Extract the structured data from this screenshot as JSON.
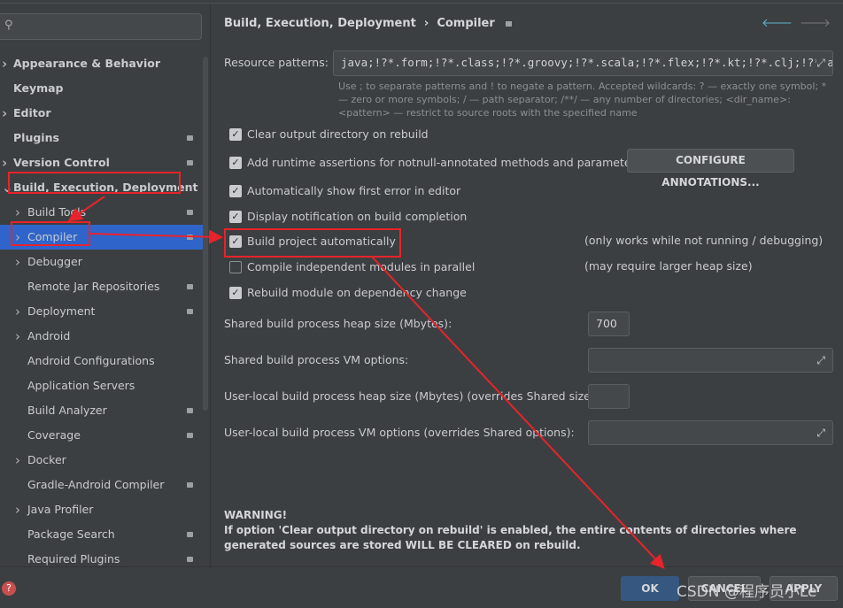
{
  "search": {
    "placeholder": ""
  },
  "sidebar": {
    "items": [
      {
        "label": "Appearance & Behavior",
        "level": 0,
        "chevron": true,
        "lock": false
      },
      {
        "label": "Keymap",
        "level": 0,
        "chevron": false,
        "lock": false
      },
      {
        "label": "Editor",
        "level": 0,
        "chevron": true,
        "lock": false
      },
      {
        "label": "Plugins",
        "level": 0,
        "chevron": false,
        "lock": true
      },
      {
        "label": "Version Control",
        "level": 0,
        "chevron": true,
        "lock": true
      },
      {
        "label": "Build, Execution, Deployment",
        "level": 0,
        "chevron": "open",
        "lock": false
      },
      {
        "label": "Build Tools",
        "level": 1,
        "chevron": true,
        "lock": true
      },
      {
        "label": "Compiler",
        "level": 1,
        "chevron": true,
        "lock": true,
        "selected": true
      },
      {
        "label": "Debugger",
        "level": 1,
        "chevron": true,
        "lock": false
      },
      {
        "label": "Remote Jar Repositories",
        "level": 1,
        "chevron": false,
        "lock": true
      },
      {
        "label": "Deployment",
        "level": 1,
        "chevron": true,
        "lock": true
      },
      {
        "label": "Android",
        "level": 1,
        "chevron": true,
        "lock": false
      },
      {
        "label": "Android Configurations",
        "level": 1,
        "chevron": false,
        "lock": false
      },
      {
        "label": "Application Servers",
        "level": 1,
        "chevron": false,
        "lock": false
      },
      {
        "label": "Build Analyzer",
        "level": 1,
        "chevron": false,
        "lock": true
      },
      {
        "label": "Coverage",
        "level": 1,
        "chevron": false,
        "lock": true
      },
      {
        "label": "Docker",
        "level": 1,
        "chevron": true,
        "lock": false
      },
      {
        "label": "Gradle-Android Compiler",
        "level": 1,
        "chevron": false,
        "lock": true
      },
      {
        "label": "Java Profiler",
        "level": 1,
        "chevron": true,
        "lock": false
      },
      {
        "label": "Package Search",
        "level": 1,
        "chevron": false,
        "lock": true
      },
      {
        "label": "Required Plugins",
        "level": 1,
        "chevron": false,
        "lock": true
      }
    ]
  },
  "header": {
    "breadcrumb_parent": "Build, Execution, Deployment",
    "separator": "›",
    "breadcrumb_current": "Compiler"
  },
  "resource": {
    "label": "Resource patterns:",
    "value": "java;!?*.form;!?*.class;!?*.groovy;!?*.scala;!?*.flex;!?*.kt;!?*.clj;!?*.aj",
    "hint": "Use ; to separate patterns and ! to negate a pattern. Accepted wildcards: ? — exactly one symbol; * — zero or more symbols; / — path separator; /**/ — any number of directories; <dir_name>:<pattern> — restrict to source roots with the specified name"
  },
  "options": [
    {
      "label": "Clear output directory on rebuild",
      "checked": true
    },
    {
      "label": "Add runtime assertions for notnull-annotated methods and parameters",
      "checked": true
    },
    {
      "label": "Automatically show first error in editor",
      "checked": true
    },
    {
      "label": "Display notification on build completion",
      "checked": true
    },
    {
      "label": "Build project automatically",
      "checked": true,
      "note": "(only works while not running / debugging)"
    },
    {
      "label": "Compile independent modules in parallel",
      "checked": false,
      "note": "(may require larger heap size)"
    },
    {
      "label": "Rebuild module on dependency change",
      "checked": true
    }
  ],
  "configure_annotations": "CONFIGURE ANNOTATIONS...",
  "fields": {
    "shared_heap_label": "Shared build process heap size (Mbytes):",
    "shared_heap_value": "700",
    "shared_vm_label": "Shared build process VM options:",
    "shared_vm_value": "",
    "local_heap_label": "User-local build process heap size (Mbytes) (overrides Shared size):",
    "local_heap_value": "",
    "local_vm_label": "User-local build process VM options (overrides Shared options):",
    "local_vm_value": ""
  },
  "warning": {
    "title": "WARNING!",
    "text": "If option 'Clear output directory on rebuild' is enabled, the entire contents of directories where generated sources are stored WILL BE CLEARED on rebuild."
  },
  "footer": {
    "ok": "OK",
    "cancel": "CANCEL",
    "apply": "APPLY",
    "help": "?"
  },
  "watermark": "CSDN @程序员小Le",
  "colors": {
    "accent": "#2f65ca",
    "annotation": "#e8232b"
  }
}
